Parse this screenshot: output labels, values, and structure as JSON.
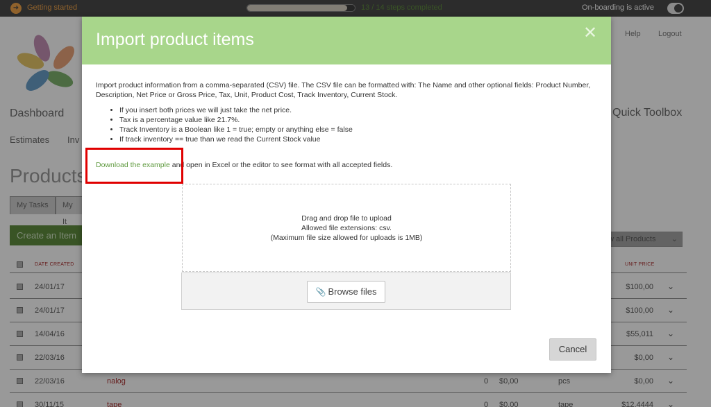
{
  "topbar": {
    "getting_started": "Getting started",
    "steps": "13 / 14 steps completed",
    "progress_fraction": 0.93,
    "onboarding": "On-boarding is active"
  },
  "header": {
    "help": "Help",
    "logout": "Logout"
  },
  "nav": {
    "dashboard": "Dashboard",
    "quick_toolbox": "Quick Toolbox",
    "estimates": "Estimates",
    "invoices_partial": "Inv"
  },
  "page": {
    "title_partial": "Products",
    "tabs": [
      {
        "label": "My Tasks"
      },
      {
        "label": "My It"
      }
    ],
    "create_button": "Create an Item",
    "filter": "w all Products",
    "columns": {
      "date": "DATE CREATED",
      "unit_price": "UNIT PRICE"
    },
    "rows": [
      {
        "date": "24/01/17",
        "name": "",
        "qty": "",
        "cost": "",
        "unit": "",
        "price": "$100,00"
      },
      {
        "date": "24/01/17",
        "name": "",
        "qty": "",
        "cost": "",
        "unit": "",
        "price": "$100,00"
      },
      {
        "date": "14/04/16",
        "name": "",
        "qty": "",
        "cost": "",
        "unit": "",
        "price": "$55,011"
      },
      {
        "date": "22/03/16",
        "name": "",
        "qty": "",
        "cost": "",
        "unit": "",
        "price": "$0,00"
      },
      {
        "date": "22/03/16",
        "name": "nalog",
        "qty": "0",
        "cost": "$0,00",
        "unit": "pcs",
        "price": "$0,00"
      },
      {
        "date": "30/11/15",
        "name": "tape",
        "qty": "0",
        "cost": "$0,00",
        "unit": "tape",
        "price": "$12,4444"
      }
    ]
  },
  "modal": {
    "title": "Import product items",
    "intro": "Import product information from a comma-separated (CSV) file. The CSV file can be formatted with: The Name and other optional fields: Product Number, Description, Net Price or Gross Price, Tax, Unit, Product Cost, Track Inventory, Current Stock.",
    "bullets": [
      "If you insert both prices we will just take the net price.",
      "Tax is a percentage value like 21.7%.",
      "Track Inventory is a Boolean like 1 = true; empty or anything else = false",
      "If track inventory == true than we read the Current Stock value"
    ],
    "download_link": "Download the example",
    "download_rest": " and open in Excel or the editor to see format with all accepted fields.",
    "drop_line1": "Drag and drop file to upload",
    "drop_line2": "Allowed file extensions: csv.",
    "drop_line3": "(Maximum file size allowed for uploads is 1MB)",
    "browse": "Browse files",
    "cancel": "Cancel"
  },
  "colors": {
    "header_green": "#a8d68b",
    "link_green": "#5f9a3f",
    "highlight": "#e00000"
  },
  "icons": {
    "close": "close-icon",
    "paperclip": "paperclip-icon",
    "chevron": "chevron-down-icon"
  }
}
